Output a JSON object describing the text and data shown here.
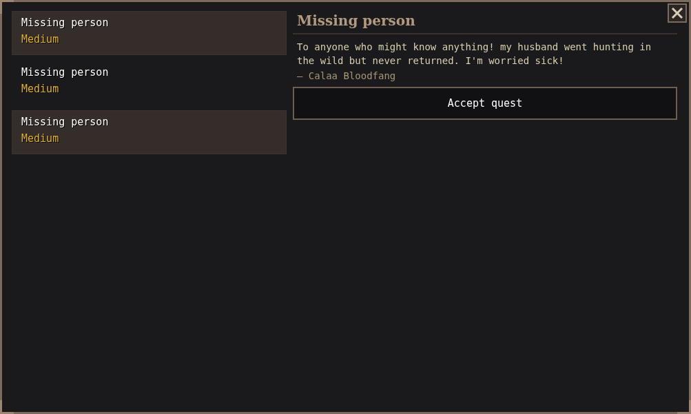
{
  "quests": [
    {
      "title": "Missing person",
      "difficulty": "Medium",
      "selected": true
    },
    {
      "title": "Missing person",
      "difficulty": "Medium",
      "selected": false
    },
    {
      "title": "Missing person",
      "difficulty": "Medium",
      "selected": true
    }
  ],
  "detail": {
    "title": "Missing person",
    "description": "To anyone who might know anything! my husband went hunting in the wild but never returned. I'm worried sick!",
    "author": "– Calaa Bloodfang",
    "button": "Accept quest"
  }
}
